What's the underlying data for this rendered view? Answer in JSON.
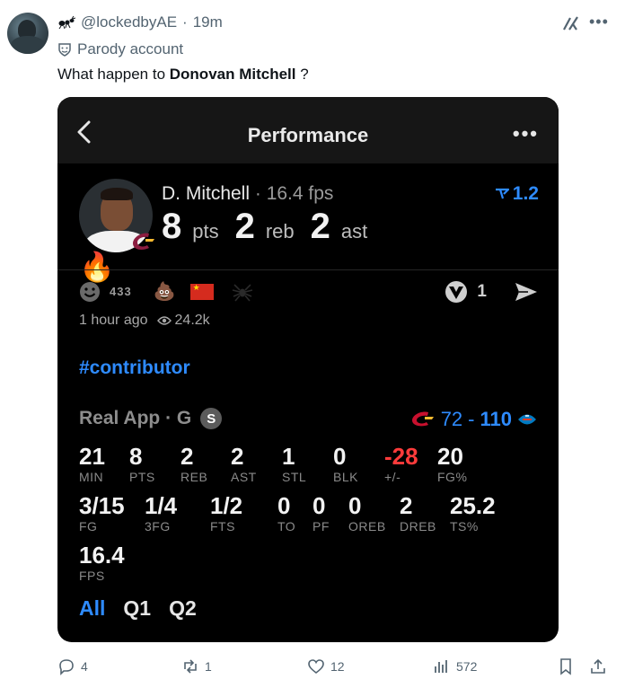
{
  "tweet": {
    "handle": "@lockedbyAE",
    "separator": "·",
    "time": "19m",
    "parody_label": "Parody account",
    "text_prefix": "What happen to ",
    "text_bold": "Donovan Mitchell",
    "text_suffix": " ?"
  },
  "card": {
    "title": "Performance",
    "player_name": "D. Mitchell",
    "fps_text": " · 16.4 fps",
    "pts_value": "8",
    "pts_label": "pts",
    "reb_value": "2",
    "reb_label": "reb",
    "ast_value": "2",
    "ast_label": "ast",
    "trend_value": "1.2",
    "reaction_count": "433",
    "v_count": "1",
    "posted": "1 hour ago",
    "views": "24.2k",
    "hashtag": "#contributor",
    "game_label": "Real App · G",
    "game_badge": "S",
    "score_home": "72",
    "score_dash": "-",
    "score_away": "110",
    "stats_row1": [
      {
        "value": "21",
        "label": "MIN"
      },
      {
        "value": "8",
        "label": "PTS"
      },
      {
        "value": "2",
        "label": "REB"
      },
      {
        "value": "2",
        "label": "AST"
      },
      {
        "value": "1",
        "label": "STL"
      },
      {
        "value": "0",
        "label": "BLK"
      },
      {
        "value": "-28",
        "label": "+/-"
      },
      {
        "value": "20",
        "label": "FG%"
      }
    ],
    "stats_row2": [
      {
        "value": "3/15",
        "label": "FG"
      },
      {
        "value": "1/4",
        "label": "3FG"
      },
      {
        "value": "1/2",
        "label": "FTS"
      },
      {
        "value": "0",
        "label": "TO"
      },
      {
        "value": "0",
        "label": "PF"
      },
      {
        "value": "0",
        "label": "OREB"
      },
      {
        "value": "2",
        "label": "DREB"
      },
      {
        "value": "25.2",
        "label": "TS%"
      }
    ],
    "stats_row3": [
      {
        "value": "16.4",
        "label": "FPS"
      }
    ],
    "tabs": [
      "All",
      "Q1",
      "Q2"
    ]
  },
  "actions": {
    "replies": "4",
    "reposts": "1",
    "likes": "12",
    "views": "572"
  },
  "colors": {
    "accent_blue": "#2e8bff",
    "negative_red": "#ff3b3b",
    "card_bg": "#000000",
    "muted_text": "#536471"
  },
  "icons": [
    "ant-icon",
    "parody-mask-icon",
    "grok-icon",
    "more-icon",
    "back-chevron-icon",
    "card-more-icon",
    "cavaliers-logo",
    "fire-icon",
    "trend-icon",
    "smile-icon",
    "poop-icon",
    "china-flag-icon",
    "spider-icon",
    "v-logo-icon",
    "send-icon",
    "eye-icon",
    "thunder-logo",
    "reply-icon",
    "repost-icon",
    "like-icon",
    "views-icon",
    "bookmark-icon",
    "share-icon"
  ]
}
